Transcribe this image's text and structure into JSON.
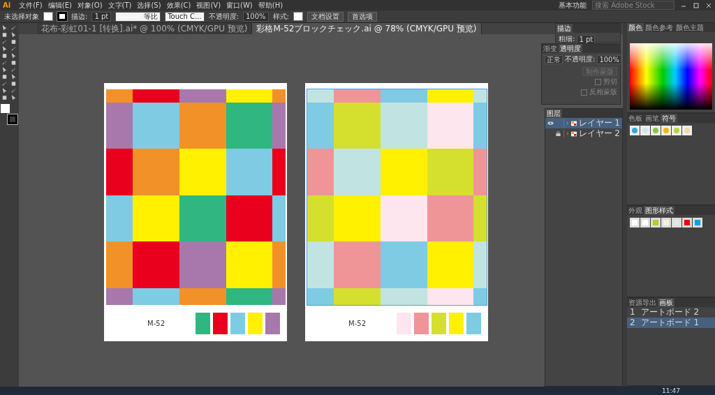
{
  "app": {
    "logo": "Ai"
  },
  "menu": [
    "文件(F)",
    "编辑(E)",
    "对象(O)",
    "文字(T)",
    "选择(S)",
    "效果(C)",
    "视图(V)",
    "窗口(W)",
    "帮助(H)"
  ],
  "workspace": "基本功能",
  "search": {
    "placeholder": "搜索 Adobe Stock"
  },
  "control_bar": {
    "selection": "未选择对象",
    "stroke_label": "描边:",
    "stroke_weight": "1 pt",
    "stroke_profile": "等比",
    "brush": "Touch C...",
    "opacity_label": "不透明度:",
    "opacity": "100%",
    "style_label": "样式:",
    "buttons": [
      "文档设置",
      "首选项"
    ]
  },
  "doc_tabs": [
    {
      "label": "花布-彩虹01-1 [转换].ai* @ 100% (CMYK/GPU 预览)",
      "selected": false
    },
    {
      "label": "彩格M-52ブロックチェック.ai @ 78% (CMYK/GPU 预览)",
      "selected": true
    }
  ],
  "artboards": [
    {
      "selected": false,
      "label": "M-52",
      "rows": [
        {
          "cells": [
            {
              "color": "#f39129"
            },
            {
              "color": "#e8001c"
            },
            {
              "color": "#a878ad"
            },
            {
              "color": "#fff100"
            },
            {
              "color": "#f39129"
            }
          ]
        },
        {
          "cells": [
            {
              "color": "#a878ad"
            },
            {
              "color": "#7ecbe3"
            },
            {
              "color": "#f39129"
            },
            {
              "color": "#30b680"
            },
            {
              "color": "#a878ad"
            }
          ]
        },
        {
          "cells": [
            {
              "color": "#e8001c"
            },
            {
              "color": "#f39129"
            },
            {
              "color": "#fff100"
            },
            {
              "color": "#7ecbe3"
            },
            {
              "color": "#e8001c"
            }
          ]
        },
        {
          "cells": [
            {
              "color": "#7ecbe3"
            },
            {
              "color": "#fff100"
            },
            {
              "color": "#30b680"
            },
            {
              "color": "#e8001c"
            },
            {
              "color": "#7ecbe3"
            }
          ]
        },
        {
          "cells": [
            {
              "color": "#f39129"
            },
            {
              "color": "#e8001c"
            },
            {
              "color": "#a878ad"
            },
            {
              "color": "#fff100"
            },
            {
              "color": "#f39129"
            }
          ]
        },
        {
          "cells": [
            {
              "color": "#a878ad"
            },
            {
              "color": "#7ecbe3"
            },
            {
              "color": "#f39129"
            },
            {
              "color": "#30b680"
            },
            {
              "color": "#a878ad"
            }
          ]
        }
      ],
      "swatches": [
        {
          "color": "#30b680"
        },
        {
          "color": "#e8001c"
        },
        {
          "color": "#7ecbe3"
        },
        {
          "color": "#fff100"
        },
        {
          "color": "#a878ad"
        }
      ]
    },
    {
      "selected": true,
      "label": "M-52",
      "rows": [
        {
          "cells": [
            {
              "color": "#c1e4e3"
            },
            {
              "color": "#f09597"
            },
            {
              "color": "#7ecbe3"
            },
            {
              "color": "#fff100"
            },
            {
              "color": "#c1e4e3"
            }
          ]
        },
        {
          "cells": [
            {
              "color": "#7ecbe3"
            },
            {
              "color": "#d4df2e"
            },
            {
              "color": "#c1e4e3"
            },
            {
              "color": "#fde6ee"
            },
            {
              "color": "#7ecbe3"
            }
          ]
        },
        {
          "cells": [
            {
              "color": "#f09597"
            },
            {
              "color": "#c1e4e3"
            },
            {
              "color": "#fff100"
            },
            {
              "color": "#d4df2e"
            },
            {
              "color": "#f09597"
            }
          ]
        },
        {
          "cells": [
            {
              "color": "#d4df2e"
            },
            {
              "color": "#fff100"
            },
            {
              "color": "#fde6ee"
            },
            {
              "color": "#f09597"
            },
            {
              "color": "#d4df2e"
            }
          ]
        },
        {
          "cells": [
            {
              "color": "#c1e4e3"
            },
            {
              "color": "#f09597"
            },
            {
              "color": "#7ecbe3"
            },
            {
              "color": "#fff100"
            },
            {
              "color": "#c1e4e3"
            }
          ]
        },
        {
          "cells": [
            {
              "color": "#7ecbe3"
            },
            {
              "color": "#d4df2e"
            },
            {
              "color": "#c1e4e3"
            },
            {
              "color": "#fde6ee"
            },
            {
              "color": "#7ecbe3"
            }
          ]
        }
      ],
      "swatches": [
        {
          "color": "#fde6ee"
        },
        {
          "color": "#f09597"
        },
        {
          "color": "#d4df2e"
        },
        {
          "color": "#fff100"
        },
        {
          "color": "#7ecbe3"
        }
      ]
    }
  ],
  "stroke_panel": {
    "title": "描边",
    "weight_label": "粗细:",
    "weight": "1 pt"
  },
  "transparency_panel": {
    "tabs": [
      {
        "label": "渐变",
        "selected": false
      },
      {
        "label": "透明度",
        "selected": true
      }
    ],
    "blend_mode": "正常",
    "opacity_label": "不透明度:",
    "opacity": "100%",
    "make_mask": "制作蒙版",
    "options": [
      {
        "label": "剪切",
        "checked": false
      },
      {
        "label": "反相蒙版",
        "checked": false
      }
    ]
  },
  "color_panel": {
    "tabs": [
      {
        "label": "颜色",
        "selected": true
      },
      {
        "label": "颜色参考",
        "selected": false
      },
      {
        "label": "颜色主题",
        "selected": false
      }
    ]
  },
  "layers_panel": {
    "title": "图层",
    "layers": [
      {
        "name": "レイヤー 1",
        "selected": true,
        "visible": true,
        "locked": false,
        "color": "#4f6edb"
      },
      {
        "name": "レイヤー 2",
        "selected": false,
        "visible": false,
        "locked": true,
        "color": "#d9383d"
      }
    ]
  },
  "symbols_panel": {
    "tabs": [
      {
        "label": "色板",
        "selected": false
      },
      {
        "label": "画笔",
        "selected": false
      },
      {
        "label": "符号",
        "selected": true
      }
    ]
  },
  "styles_panel": {
    "tabs": [
      {
        "label": "外观",
        "selected": false
      },
      {
        "label": "图形样式",
        "selected": true
      }
    ]
  },
  "artboards_panel": {
    "tabs": [
      {
        "label": "资源导出",
        "selected": false
      },
      {
        "label": "画板",
        "selected": true
      }
    ],
    "items": [
      {
        "number": "1",
        "name": "アートボード 2",
        "selected": false
      },
      {
        "number": "2",
        "name": "アートボード 1",
        "selected": true
      }
    ]
  },
  "taskbar": {
    "time": "11:47"
  }
}
